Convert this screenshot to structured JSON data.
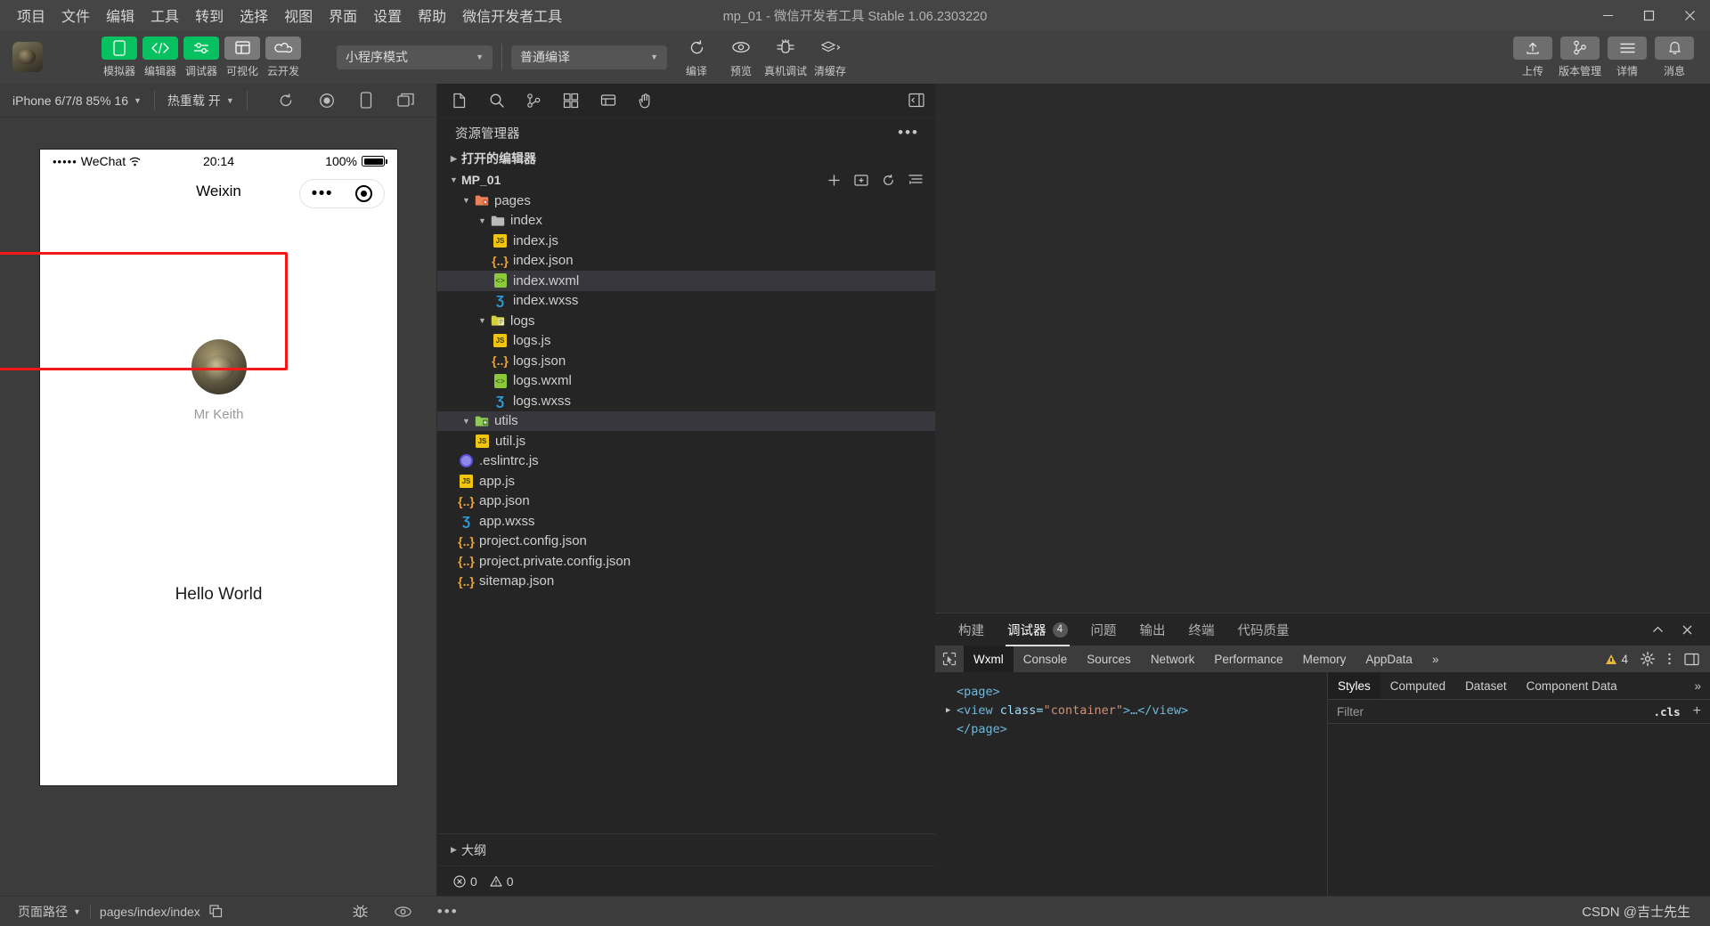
{
  "titlebar": {
    "menu": [
      "项目",
      "文件",
      "编辑",
      "工具",
      "转到",
      "选择",
      "视图",
      "界面",
      "设置",
      "帮助",
      "微信开发者工具"
    ],
    "title": "mp_01 - 微信开发者工具 Stable 1.06.2303220",
    "minimize": "minimize-icon",
    "maximize": "maximize-icon",
    "close": "close-icon"
  },
  "toolbar": {
    "left_buttons": [
      {
        "label": "模拟器",
        "icon": "phone-icon",
        "style": "green"
      },
      {
        "label": "编辑器",
        "icon": "code-icon",
        "style": "green"
      },
      {
        "label": "调试器",
        "icon": "sliders-icon",
        "style": "green"
      },
      {
        "label": "可视化",
        "icon": "layout-icon",
        "style": "grey"
      },
      {
        "label": "云开发",
        "icon": "cloud-icon",
        "style": "grey"
      }
    ],
    "mode_select": "小程序模式",
    "compile_select": "普通编译",
    "actions": [
      {
        "label": "编译",
        "icon": "refresh-icon"
      },
      {
        "label": "预览",
        "icon": "eye-icon"
      },
      {
        "label": "真机调试",
        "icon": "device-debug-icon"
      },
      {
        "label": "清缓存",
        "icon": "layers-icon"
      }
    ],
    "right_buttons": [
      {
        "label": "上传",
        "icon": "upload-icon"
      },
      {
        "label": "版本管理",
        "icon": "branch-icon"
      },
      {
        "label": "详情",
        "icon": "menu-icon"
      },
      {
        "label": "消息",
        "icon": "bell-icon"
      }
    ]
  },
  "simulator": {
    "device": "iPhone 6/7/8 85% 16",
    "hot_reload": "热重载 开",
    "icons": [
      "refresh-icon",
      "record-icon",
      "rotate-device-icon",
      "multi-window-icon"
    ],
    "phone": {
      "carrier": "WeChat",
      "signal_dots": "•••••",
      "time": "20:14",
      "battery_percent": "100%",
      "nav_title": "Weixin",
      "user_name": "Mr Keith",
      "hello": "Hello World"
    }
  },
  "explorer": {
    "toolbar_icons": [
      "files-icon",
      "search-icon",
      "source-control-icon",
      "extensions-icon",
      "debug-icon",
      "testing-icon",
      "hand-icon",
      "collapse-panel-icon"
    ],
    "header": "资源管理器",
    "header_more": "more-icon",
    "open_editors": "打开的编辑器",
    "project_name": "MP_01",
    "project_actions": [
      "new-file-icon",
      "new-folder-icon",
      "refresh-icon",
      "collapse-all-icon"
    ],
    "tree": [
      {
        "name": "pages",
        "type": "folder",
        "indent": 1,
        "expanded": true,
        "icon": "folder-pages-icon"
      },
      {
        "name": "index",
        "type": "folder",
        "indent": 2,
        "expanded": true,
        "icon": "folder-icon"
      },
      {
        "name": "index.js",
        "type": "js",
        "indent": 3
      },
      {
        "name": "index.json",
        "type": "json",
        "indent": 3
      },
      {
        "name": "index.wxml",
        "type": "wxml",
        "indent": 3,
        "selected": true
      },
      {
        "name": "index.wxss",
        "type": "wxss",
        "indent": 3
      },
      {
        "name": "logs",
        "type": "folder",
        "indent": 2,
        "expanded": true,
        "icon": "folder-logs-icon"
      },
      {
        "name": "logs.js",
        "type": "js",
        "indent": 3
      },
      {
        "name": "logs.json",
        "type": "json",
        "indent": 3
      },
      {
        "name": "logs.wxml",
        "type": "wxml",
        "indent": 3
      },
      {
        "name": "logs.wxss",
        "type": "wxss",
        "indent": 3
      },
      {
        "name": "utils",
        "type": "folder",
        "indent": 1,
        "expanded": true,
        "icon": "folder-utils-icon",
        "highlighted": true
      },
      {
        "name": "util.js",
        "type": "js",
        "indent": 2
      },
      {
        "name": ".eslintrc.js",
        "type": "eslint",
        "indent": 1
      },
      {
        "name": "app.js",
        "type": "js",
        "indent": 1
      },
      {
        "name": "app.json",
        "type": "json",
        "indent": 1
      },
      {
        "name": "app.wxss",
        "type": "wxss",
        "indent": 1
      },
      {
        "name": "project.config.json",
        "type": "json",
        "indent": 1
      },
      {
        "name": "project.private.config.json",
        "type": "json",
        "indent": 1
      },
      {
        "name": "sitemap.json",
        "type": "json",
        "indent": 1
      }
    ],
    "outline": "大纲",
    "problems": {
      "errors": "0",
      "warnings": "0"
    }
  },
  "devtools": {
    "panel_tabs": [
      {
        "label": "构建",
        "active": false
      },
      {
        "label": "调试器",
        "active": true,
        "badge": "4"
      },
      {
        "label": "问题",
        "active": false
      },
      {
        "label": "输出",
        "active": false
      },
      {
        "label": "终端",
        "active": false
      },
      {
        "label": "代码质量",
        "active": false
      }
    ],
    "panel_collapse": "chevron-up-icon",
    "panel_close": "close-icon",
    "inspector_icon": "inspect-element-icon",
    "tabs": [
      "Wxml",
      "Console",
      "Sources",
      "Network",
      "Performance",
      "Memory",
      "AppData"
    ],
    "active_tab": "Wxml",
    "overflow": "»",
    "warning_count": "4",
    "settings_icon": "gear-icon",
    "more_icon": "kebab-menu-icon",
    "dock_icon": "dock-panel-icon",
    "wxml": {
      "line1": "<page>",
      "line2_tag_open": "<view ",
      "line2_attr": "class=",
      "line2_value": "\"container\"",
      "line2_rest": ">…</view>",
      "line3": "</page>"
    },
    "styles": {
      "tabs": [
        "Styles",
        "Computed",
        "Dataset",
        "Component Data"
      ],
      "active_tab": "Styles",
      "overflow": "»",
      "filter_placeholder": "Filter",
      "cls": ".cls",
      "add": "+"
    }
  },
  "statusbar": {
    "page_path_label": "页面路径",
    "page_path": "pages/index/index",
    "copy_icon": "copy-icon",
    "icons": [
      "bug-icon",
      "eye-icon",
      "more-icon"
    ],
    "watermark": "CSDN @吉士先生"
  },
  "colors": {
    "accent_green": "#07c160",
    "highlight_red": "#f61818",
    "titlebar_bg": "#454545",
    "toolbar_bg": "#414141",
    "explorer_bg": "#252526"
  }
}
